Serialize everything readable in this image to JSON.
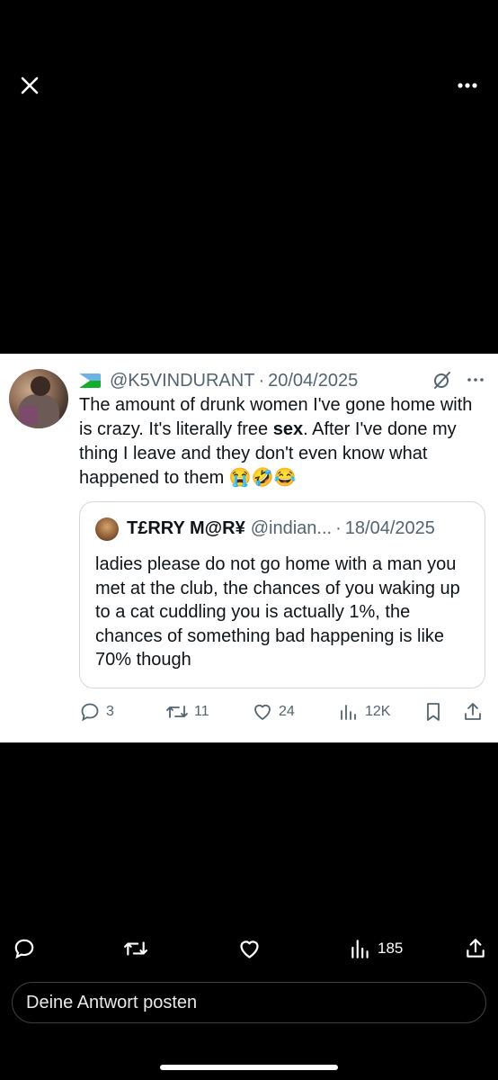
{
  "top_bar": {
    "close_icon": "close-icon",
    "more_icon": "more-horizontal-icon"
  },
  "tweet": {
    "flag_icon": "djibouti-flag-icon",
    "handle": "@K5VINDURANT",
    "separator": "·",
    "date": "20/04/2025",
    "text_before": "The amount of drunk women I've gone home with is crazy. It's literally free ",
    "text_bold": "sex",
    "text_after": ". After I've done my thing I leave and they don't even know what happened to them ",
    "emojis": "😭🤣😂",
    "quote": {
      "name": "T£RRY M@R¥",
      "handle": "@indian...",
      "separator": "·",
      "date": "18/04/2025",
      "text": "ladies please do not go home with a man you met at the club, the chances of you waking up to a cat cuddling you is actually 1%, the chances of something bad happening is like 70% though"
    },
    "actions": {
      "replies": "3",
      "reposts": "11",
      "likes": "24",
      "views": "12K"
    }
  },
  "bottom_bar": {
    "views": "185"
  },
  "reply": {
    "placeholder": "Deine Antwort posten"
  },
  "colors": {
    "background": "#000000",
    "card": "#ffffff",
    "text": "#0f1419",
    "secondary": "#536471"
  }
}
